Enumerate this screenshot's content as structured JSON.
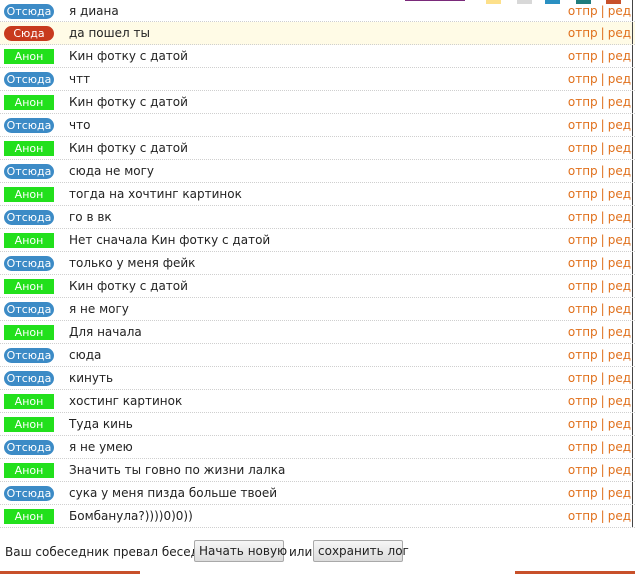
{
  "colors": {
    "otsuda": "#3c8bc6",
    "syuda": "#c83a1e",
    "anon": "#22e01c",
    "action": "#e0701c",
    "highlight_row": "#fffbe6"
  },
  "actions": {
    "send": "отпр",
    "edit": "ред",
    "separator": "|"
  },
  "messages": [
    {
      "sender": "Отсюда",
      "type": "otsuda",
      "text": "я диана"
    },
    {
      "sender": "Сюда",
      "type": "syuda",
      "text": "да пошел ты",
      "highlight": true
    },
    {
      "sender": "Анон",
      "type": "anon",
      "text": "Кин фотку с датой"
    },
    {
      "sender": "Отсюда",
      "type": "otsuda",
      "text": "чтт"
    },
    {
      "sender": "Анон",
      "type": "anon",
      "text": "Кин фотку с датой"
    },
    {
      "sender": "Отсюда",
      "type": "otsuda",
      "text": "что"
    },
    {
      "sender": "Анон",
      "type": "anon",
      "text": "Кин фотку с датой"
    },
    {
      "sender": "Отсюда",
      "type": "otsuda",
      "text": "сюда не могу"
    },
    {
      "sender": "Анон",
      "type": "anon",
      "text": "тогда на хочтинг картинок"
    },
    {
      "sender": "Отсюда",
      "type": "otsuda",
      "text": "го в вк"
    },
    {
      "sender": "Анон",
      "type": "anon",
      "text": "Нет сначала Кин фотку с датой"
    },
    {
      "sender": "Отсюда",
      "type": "otsuda",
      "text": "только у меня фейк"
    },
    {
      "sender": "Анон",
      "type": "anon",
      "text": "Кин фотку с датой"
    },
    {
      "sender": "Отсюда",
      "type": "otsuda",
      "text": "я не могу"
    },
    {
      "sender": "Анон",
      "type": "anon",
      "text": "Для начала"
    },
    {
      "sender": "Отсюда",
      "type": "otsuda",
      "text": "сюда"
    },
    {
      "sender": "Отсюда",
      "type": "otsuda",
      "text": "кинуть"
    },
    {
      "sender": "Анон",
      "type": "anon",
      "text": "хостинг картинок"
    },
    {
      "sender": "Анон",
      "type": "anon",
      "text": "Туда кинь"
    },
    {
      "sender": "Отсюда",
      "type": "otsuda",
      "text": "я не умею"
    },
    {
      "sender": "Анон",
      "type": "anon",
      "text": "Значить ты говно по жизни лалка"
    },
    {
      "sender": "Отсюда",
      "type": "otsuda",
      "text": "сука у меня пизда больше твоей"
    },
    {
      "sender": "Анон",
      "type": "anon",
      "text": "Бомбанула?))))0)0))"
    }
  ],
  "footer": {
    "status": "Ваш собеседник превал беседу.",
    "new_button": "Начать новую",
    "or": "или",
    "save_button": "сохранить лог"
  }
}
